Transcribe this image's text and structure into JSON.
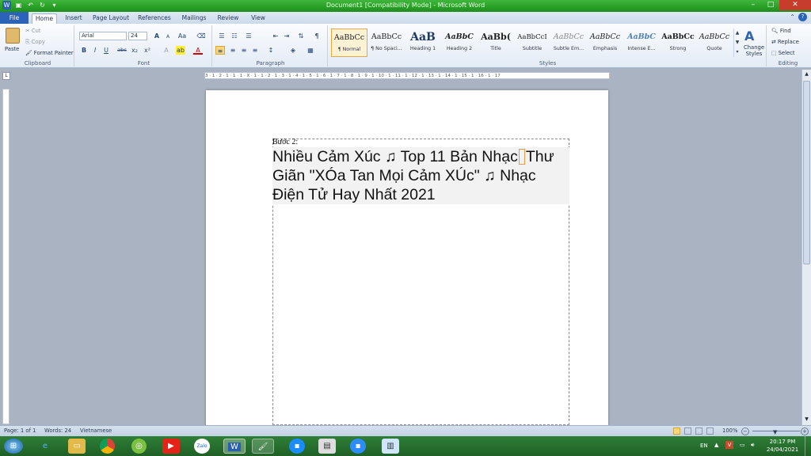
{
  "window": {
    "title": "Document1 [Compatibility Mode] - Microsoft Word",
    "min": "–",
    "max": "□",
    "close": "✕"
  },
  "tabs": [
    "File",
    "Home",
    "Insert",
    "Page Layout",
    "References",
    "Mailings",
    "Review",
    "View"
  ],
  "clipboard": {
    "paste": "Paste",
    "cut": "Cut",
    "copy": "Copy",
    "format_painter": "Format Painter",
    "label": "Clipboard"
  },
  "font": {
    "name": "Arial",
    "size": "24",
    "label": "Font",
    "bold": "B",
    "italic": "I",
    "underline": "U",
    "strike": "abc",
    "sub": "x₂",
    "sup": "x²",
    "grow": "A",
    "shrink": "A",
    "case": "Aa"
  },
  "paragraph": {
    "label": "Paragraph",
    "pilcrow": "¶"
  },
  "styles": {
    "label": "Styles",
    "items": [
      {
        "preview": "AaBbCc",
        "name": "¶ Normal"
      },
      {
        "preview": "AaBbCc",
        "name": "¶ No Spaci..."
      },
      {
        "preview": "AaB",
        "name": "Heading 1"
      },
      {
        "preview": "AaBbC",
        "name": "Heading 2"
      },
      {
        "preview": "AaBb(",
        "name": "Title"
      },
      {
        "preview": "AaBbCcI",
        "name": "Subtitle"
      },
      {
        "preview": "AaBbCc",
        "name": "Subtle Em..."
      },
      {
        "preview": "AaBbCc",
        "name": "Emphasis"
      },
      {
        "preview": "AaBbC",
        "name": "Intense E..."
      },
      {
        "preview": "AaBbCc",
        "name": "Strong"
      },
      {
        "preview": "AaBbCc",
        "name": "Quote"
      }
    ],
    "change": "Change Styles"
  },
  "editing": {
    "find": "Find",
    "replace": "Replace",
    "select": "Select",
    "label": "Editing"
  },
  "ruler": "3 · 1 · 2 · 1 · 1 · 1 · X · 1 · 1 · 2 · 1 · 3 · 1 · 4 · 1 · 5 · 1 · 6 · 1 · 7 · 1 · 8 · 1 · 9 · 1 · 10 · 1 · 11 · 1 · 12 · 1 · 13 · 1 · 14 · 1 · 15 · 1 · 16 · 1 · 17",
  "document": {
    "step": "Bước 2:",
    "line1a": "Nhiều Cảm Xúc ♫ Top 11 Bản Nhạc",
    "line1b": "Thư",
    "line2": "Giãn \"XÓa Tan Mọi Cảm XÚc\" ♫ Nhạc",
    "line3": "Điện Tử Hay Nhất 2021"
  },
  "status": {
    "page": "Page: 1 of 1",
    "words": "Words: 24",
    "lang": "Vietnamese",
    "zoom": "100%"
  },
  "taskbar": {
    "lang": "EN",
    "time": "20:17 PM",
    "date": "24/04/2021"
  }
}
